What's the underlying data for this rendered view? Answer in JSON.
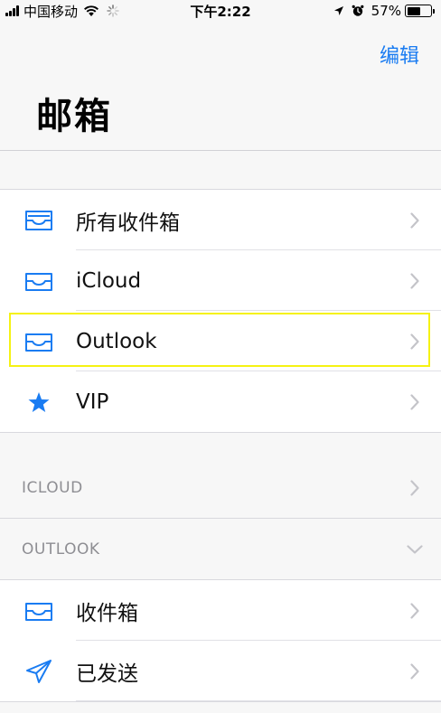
{
  "status_bar": {
    "carrier": "中国移动",
    "time": "下午2:22",
    "battery": "57%",
    "battery_level": 0.57
  },
  "nav": {
    "edit_label": "编辑",
    "title": "邮箱"
  },
  "mailboxes": [
    {
      "label": "所有收件箱",
      "icon": "inbox-stack-icon"
    },
    {
      "label": "iCloud",
      "icon": "inbox-icon"
    },
    {
      "label": "Outlook",
      "icon": "inbox-icon"
    },
    {
      "label": "VIP",
      "icon": "star-icon"
    }
  ],
  "accounts": [
    {
      "label": "ICLOUD",
      "expanded": false
    },
    {
      "label": "OUTLOOK",
      "expanded": true
    }
  ],
  "outlook_folders": [
    {
      "label": "收件箱",
      "icon": "inbox-icon"
    },
    {
      "label": "已发送",
      "icon": "paper-plane-icon"
    }
  ],
  "colors": {
    "accent": "#1a7cf2",
    "highlight": "#f5f213",
    "secondary_text": "#8e8e93"
  }
}
